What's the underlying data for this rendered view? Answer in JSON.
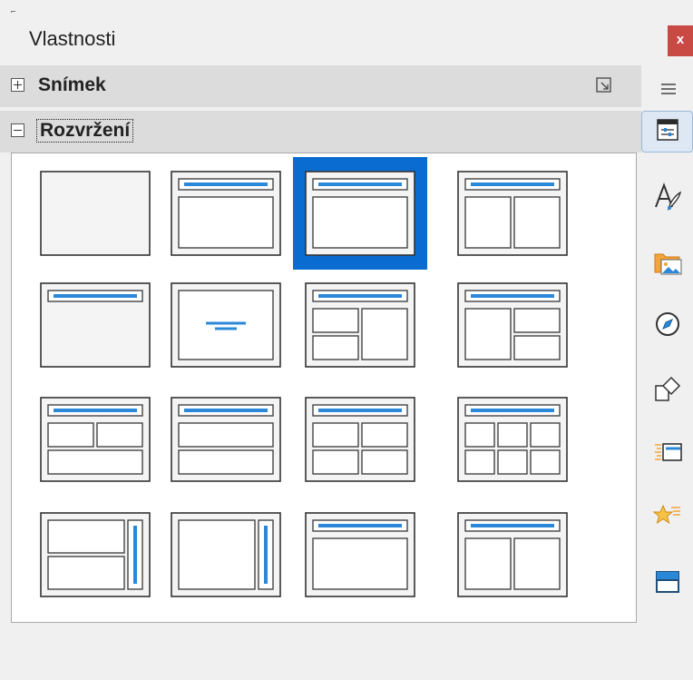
{
  "window": {
    "title": "Vlastnosti",
    "close_glyph": "x"
  },
  "sections": {
    "snimek": {
      "title": "Snímek",
      "expanded": false,
      "expander": "plus"
    },
    "rozvrzeni": {
      "title": "Rozvržení",
      "expanded": true,
      "expander": "minus"
    }
  },
  "layouts": {
    "selected_index": 2,
    "items": [
      {
        "kind": "blank"
      },
      {
        "kind": "title-centered-text"
      },
      {
        "kind": "title-content"
      },
      {
        "kind": "title-2-content"
      },
      {
        "kind": "title-only"
      },
      {
        "kind": "centered-text"
      },
      {
        "kind": "title-2content-left-content-right"
      },
      {
        "kind": "title-content-left-2content-right"
      },
      {
        "kind": "title-2content-top-content"
      },
      {
        "kind": "title-content-over-content"
      },
      {
        "kind": "title-4-content"
      },
      {
        "kind": "title-6-content"
      },
      {
        "kind": "vertical-title-text-chart"
      },
      {
        "kind": "vertical-title-vertical-text"
      },
      {
        "kind": "title-vertical-text"
      },
      {
        "kind": "title-vertical-text-clipart"
      }
    ]
  },
  "tabbar": {
    "menu_icon": "hamburger-menu-icon",
    "tabs": [
      {
        "name": "properties",
        "icon": "properties-icon",
        "active": true
      },
      {
        "name": "styles",
        "icon": "styles-icon",
        "active": false
      },
      {
        "name": "gallery",
        "icon": "gallery-icon",
        "active": false
      },
      {
        "name": "navigator",
        "icon": "navigator-icon",
        "active": false
      },
      {
        "name": "shapes",
        "icon": "shapes-icon",
        "active": false
      },
      {
        "name": "slide-transition",
        "icon": "slide-transition-icon",
        "active": false
      },
      {
        "name": "animation",
        "icon": "animation-icon",
        "active": false
      },
      {
        "name": "master-slides",
        "icon": "master-slides-icon",
        "active": false
      }
    ]
  },
  "colors": {
    "accent": "#0a6cd0",
    "title_bar_blue": "#2b88d8",
    "close_button": "#c94a45",
    "section_header": "#dcdcdc"
  }
}
